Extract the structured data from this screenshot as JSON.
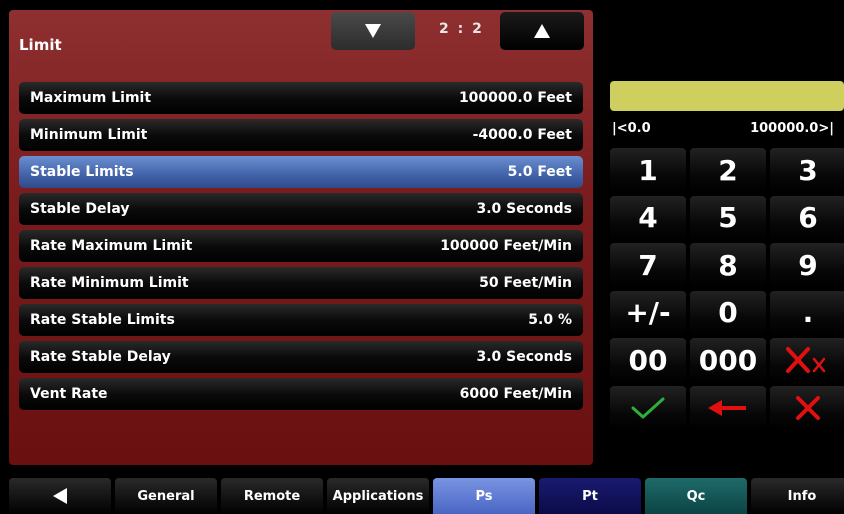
{
  "panel": {
    "title": "Limit",
    "page_indicator": "2 : 2",
    "page_down_icon": "triangle-down-icon",
    "page_up_icon": "triangle-up-icon"
  },
  "rows": [
    {
      "label": "Maximum Limit",
      "value": "100000.0 Feet"
    },
    {
      "label": "Minimum Limit",
      "value": "-4000.0 Feet"
    },
    {
      "label": "Stable Limits",
      "value": "5.0 Feet"
    },
    {
      "label": "Stable Delay",
      "value": "3.0 Seconds"
    },
    {
      "label": "Rate Maximum Limit",
      "value": "100000 Feet/Min"
    },
    {
      "label": "Rate Minimum Limit",
      "value": "50 Feet/Min"
    },
    {
      "label": "Rate Stable Limits",
      "value": "5.0 %"
    },
    {
      "label": "Rate Stable Delay",
      "value": "3.0 Seconds"
    },
    {
      "label": "Vent Rate",
      "value": "6000 Feet/Min"
    }
  ],
  "selected_row": "Stable Limits",
  "keypad": {
    "display_value": "",
    "range_min": "|<0.0",
    "range_max": "100000.0>|",
    "keys": [
      "1",
      "2",
      "3",
      "4",
      "5",
      "6",
      "7",
      "8",
      "9",
      "+/-",
      "0",
      ".",
      "00",
      "000"
    ],
    "clear_entry_icon": "clear-x-icon",
    "accept_icon": "check-icon",
    "backspace_icon": "left-arrow-icon",
    "cancel_icon": "close-icon"
  },
  "tabs": {
    "back_icon": "triangle-left-icon",
    "labels": [
      "General",
      "Remote",
      "Applications",
      "Ps",
      "Pt",
      "Qc",
      "Info"
    ]
  },
  "colors": {
    "panel_bg": "#7b1c1e",
    "selected_row": "#4566ac",
    "display_bg": "#cfcf60",
    "red": "#e01010",
    "green": "#2fae3a",
    "tab_ps": "#5a76d4",
    "tab_pt": "#0b0b4a",
    "tab_qc": "#0c4444"
  }
}
